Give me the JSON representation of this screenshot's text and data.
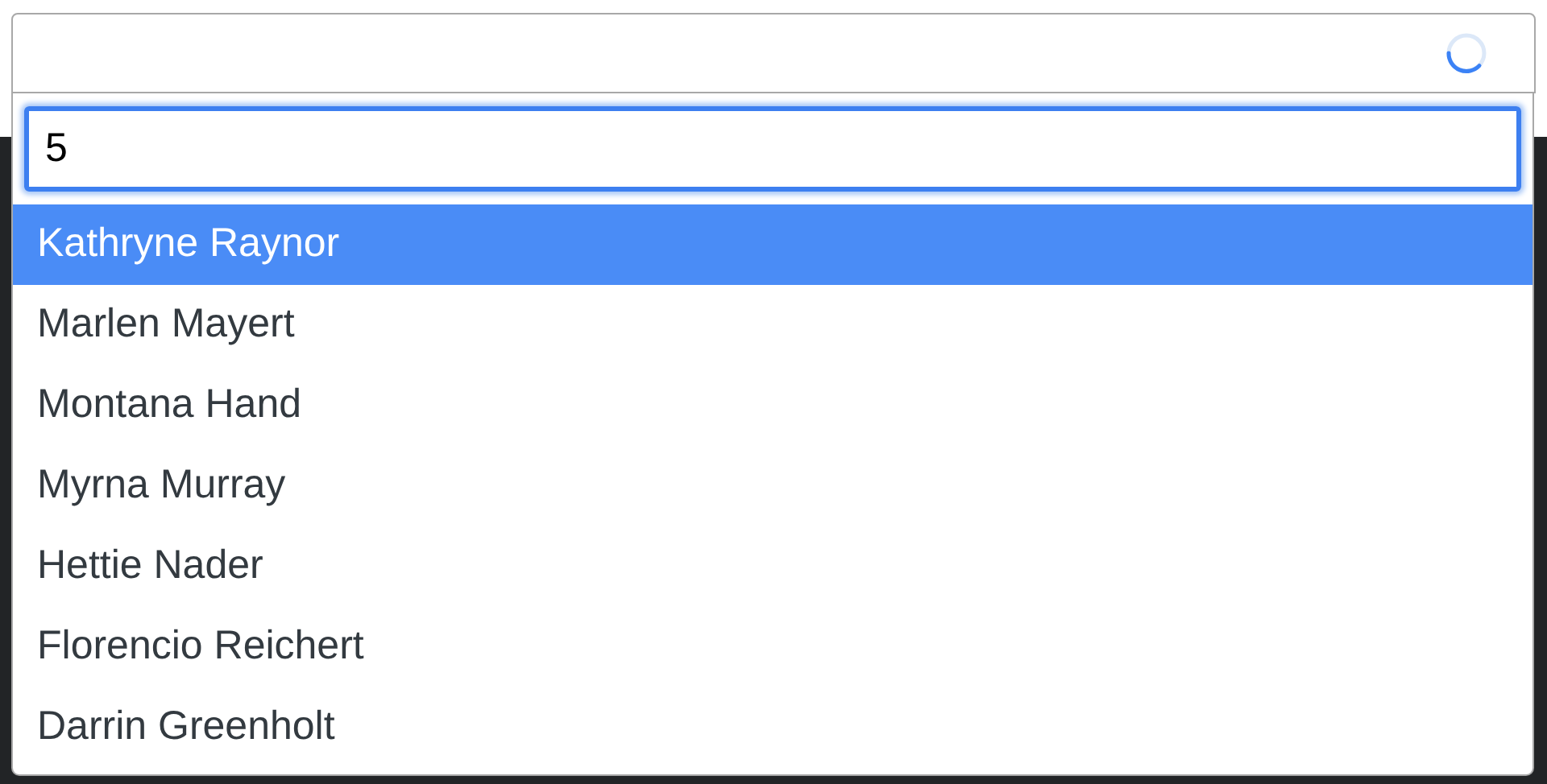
{
  "select": {
    "loading": true
  },
  "search": {
    "value": "5"
  },
  "options": [
    {
      "label": "Kathryne Raynor",
      "selected": true
    },
    {
      "label": "Marlen Mayert",
      "selected": false
    },
    {
      "label": "Montana Hand",
      "selected": false
    },
    {
      "label": "Myrna Murray",
      "selected": false
    },
    {
      "label": "Hettie Nader",
      "selected": false
    },
    {
      "label": "Florencio Reichert",
      "selected": false
    },
    {
      "label": "Darrin Greenholt",
      "selected": false
    }
  ]
}
